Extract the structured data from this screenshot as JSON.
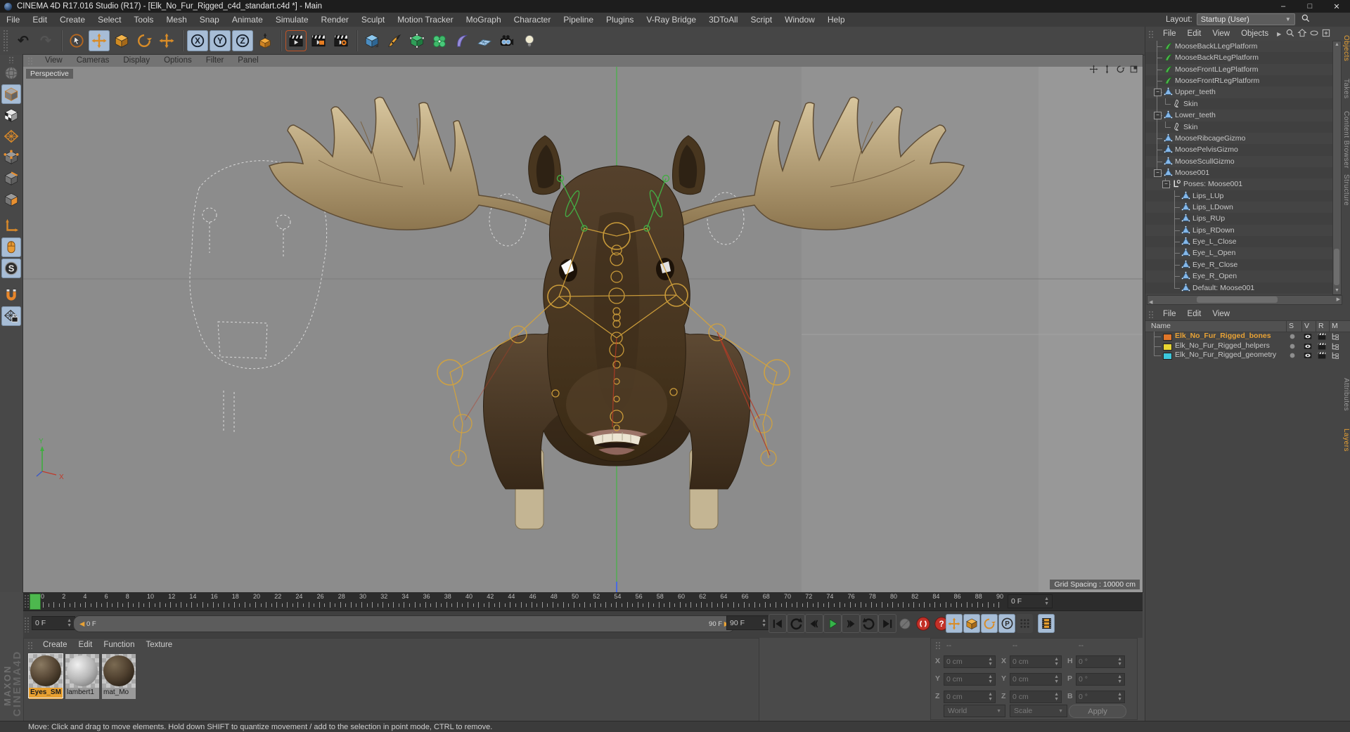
{
  "window": {
    "title": "CINEMA 4D R17.016 Studio (R17) - [Elk_No_Fur_Rigged_c4d_standart.c4d *] - Main"
  },
  "menu_bar": {
    "items": [
      "File",
      "Edit",
      "Create",
      "Select",
      "Tools",
      "Mesh",
      "Snap",
      "Animate",
      "Simulate",
      "Render",
      "Sculpt",
      "Motion Tracker",
      "MoGraph",
      "Character",
      "Pipeline",
      "Plugins",
      "V-Ray Bridge",
      "3DToAll",
      "Script",
      "Window",
      "Help"
    ],
    "layout_label": "Layout:",
    "layout_value": "Startup (User)"
  },
  "toolbar": {
    "tools": [
      {
        "name": "undo",
        "icon": "undo"
      },
      {
        "name": "redo",
        "icon": "redo",
        "disabled": true
      },
      {
        "sep": true
      },
      {
        "name": "live-selection",
        "icon": "live-selection"
      },
      {
        "name": "move-tool",
        "icon": "move",
        "selected": true
      },
      {
        "name": "scale-tool",
        "icon": "scale"
      },
      {
        "name": "rotate-tool",
        "icon": "rotate"
      },
      {
        "name": "last-used-tool",
        "icon": "move"
      },
      {
        "sep": true
      },
      {
        "name": "lock-x-axis",
        "icon": "axis-x",
        "selected": true
      },
      {
        "name": "lock-y-axis",
        "icon": "axis-y",
        "selected": true
      },
      {
        "name": "lock-z-axis",
        "icon": "axis-z",
        "selected": true
      },
      {
        "name": "coordinate-system",
        "icon": "coord-system"
      },
      {
        "sep": true
      },
      {
        "name": "render-view",
        "icon": "render-view",
        "outlined": true
      },
      {
        "name": "render-picture-viewer",
        "icon": "render-pv"
      },
      {
        "name": "render-settings",
        "icon": "render-settings"
      },
      {
        "sep": true
      },
      {
        "name": "add-cube-primitive",
        "icon": "cube-primitive"
      },
      {
        "name": "add-spline-pen",
        "icon": "pen-spline"
      },
      {
        "name": "add-subdivision-surface",
        "icon": "subdivision"
      },
      {
        "name": "add-mograph-object",
        "icon": "mograph"
      },
      {
        "name": "add-deformer",
        "icon": "deformer"
      },
      {
        "name": "add-environment-floor",
        "icon": "floor"
      },
      {
        "name": "add-camera",
        "icon": "camera"
      },
      {
        "name": "add-light",
        "icon": "light"
      }
    ]
  },
  "left_toolbar": {
    "tools": [
      {
        "name": "viewport-navigation-globe",
        "icon": "globe",
        "disabled": true
      },
      {
        "name": "model-mode",
        "icon": "model-mode",
        "selected": true
      },
      {
        "name": "texture-mode",
        "icon": "texture-mode"
      },
      {
        "name": "workplane-mode",
        "icon": "workplane"
      },
      {
        "name": "points-mode",
        "icon": "points-mode"
      },
      {
        "name": "edges-mode",
        "icon": "edges-mode"
      },
      {
        "name": "polygons-mode",
        "icon": "polygons-mode"
      },
      {
        "name": "enable-axis-modification",
        "icon": "axis-mode",
        "gap": 8
      },
      {
        "name": "viewport-interaction-mouse",
        "icon": "mouse",
        "selected": true
      },
      {
        "name": "enable-snap",
        "icon": "snap-s",
        "selected": true
      },
      {
        "name": "magnet-tool",
        "icon": "magnet",
        "gap": 8
      },
      {
        "name": "workplane-snap",
        "icon": "grid-lock",
        "selected": true
      }
    ]
  },
  "viewport": {
    "menu": [
      "View",
      "Cameras",
      "Display",
      "Options",
      "Filter",
      "Panel"
    ],
    "camera_label": "Perspective",
    "grid_spacing_label": "Grid Spacing : 10000 cm",
    "axis_labels": {
      "x": "X",
      "y": "Y"
    },
    "nav_icons": [
      "pan-icon",
      "dolly-icon",
      "orbit-icon",
      "maximize-view-icon"
    ]
  },
  "object_manager": {
    "menu": [
      "File",
      "Edit",
      "View",
      "Objects"
    ],
    "header_icons": [
      "search-icon",
      "home-icon",
      "eye-filter-icon",
      "add-layer-icon"
    ],
    "tabs": [
      {
        "label": "Objects",
        "active": true
      },
      {
        "label": "Takes",
        "active": false
      },
      {
        "label": "Content Browser",
        "active": false
      },
      {
        "label": "Structure",
        "active": false
      }
    ],
    "tree": [
      {
        "label": "MooseBackLLegPlatform",
        "icon": "spline",
        "indent": 1,
        "conn": "mid"
      },
      {
        "label": "MooseBackRLegPlatform",
        "icon": "spline",
        "indent": 1,
        "conn": "mid"
      },
      {
        "label": "MooseFrontLLegPlatform",
        "icon": "spline",
        "indent": 1,
        "conn": "mid"
      },
      {
        "label": "MooseFrontRLegPlatform",
        "icon": "spline",
        "indent": 1,
        "conn": "mid"
      },
      {
        "label": "Upper_teeth",
        "icon": "joint",
        "indent": 1,
        "conn": "mid",
        "expand": true
      },
      {
        "label": "Skin",
        "icon": "skin",
        "indent": 2,
        "conn": "end",
        "guide1": true
      },
      {
        "label": "Lower_teeth",
        "icon": "joint",
        "indent": 1,
        "conn": "mid",
        "expand": true
      },
      {
        "label": "Skin",
        "icon": "skin",
        "indent": 2,
        "conn": "end",
        "guide1": true
      },
      {
        "label": "MooseRibcageGizmo",
        "icon": "joint",
        "indent": 1,
        "conn": "mid"
      },
      {
        "label": "MoosePelvisGizmo",
        "icon": "joint",
        "indent": 1,
        "conn": "mid"
      },
      {
        "label": "MooseScullGizmo",
        "icon": "joint",
        "indent": 1,
        "conn": "mid"
      },
      {
        "label": "Moose001",
        "icon": "joint",
        "indent": 1,
        "conn": "end",
        "expand": true
      },
      {
        "label": "Poses: Moose001",
        "icon": "posemorph",
        "indent": 2,
        "conn": "end",
        "expand": true
      },
      {
        "label": "Lips_LUp",
        "icon": "joint",
        "indent": 3,
        "conn": "mid"
      },
      {
        "label": "Lips_LDown",
        "icon": "joint",
        "indent": 3,
        "conn": "mid"
      },
      {
        "label": "Lips_RUp",
        "icon": "joint",
        "indent": 3,
        "conn": "mid"
      },
      {
        "label": "Lips_RDown",
        "icon": "joint",
        "indent": 3,
        "conn": "mid"
      },
      {
        "label": "Eye_L_Close",
        "icon": "joint",
        "indent": 3,
        "conn": "mid"
      },
      {
        "label": "Eye_L_Open",
        "icon": "joint",
        "indent": 3,
        "conn": "mid"
      },
      {
        "label": "Eye_R_Close",
        "icon": "joint",
        "indent": 3,
        "conn": "mid"
      },
      {
        "label": "Eye_R_Open",
        "icon": "joint",
        "indent": 3,
        "conn": "mid"
      },
      {
        "label": "Default: Moose001",
        "icon": "joint",
        "indent": 3,
        "conn": "end"
      }
    ]
  },
  "layer_manager": {
    "menu": [
      "File",
      "Edit",
      "View"
    ],
    "name_column": "Name",
    "columns": [
      "S",
      "V",
      "R",
      "M"
    ],
    "tabs": [
      {
        "label": "Attributes",
        "active": false
      },
      {
        "label": "Layers",
        "active": true
      }
    ],
    "layers": [
      {
        "label": "Elk_No_Fur_Rigged_bones",
        "color": "#e0762a",
        "selected": true
      },
      {
        "label": "Elk_No_Fur_Rigged_helpers",
        "color": "#e8d532",
        "selected": false
      },
      {
        "label": "Elk_No_Fur_Rigged_geometry",
        "color": "#3cc8dc",
        "selected": false
      }
    ]
  },
  "timeline": {
    "ruler_start": 0,
    "ruler_end": 90,
    "ruler_step": 2,
    "current_frame_label": "0 F",
    "slider_min_label": "0 F",
    "slider_max_label": "90 F",
    "max_frame_label": "90 F",
    "top_right_spinner_label": "0 F",
    "transport": [
      {
        "name": "goto-start-button",
        "icon": "goto-start"
      },
      {
        "name": "play-backwards-button",
        "icon": "arc-left"
      },
      {
        "name": "previous-frame-button",
        "icon": "tri-left"
      },
      {
        "name": "play-forwards-button",
        "icon": "play"
      },
      {
        "name": "next-frame-button",
        "icon": "tri-right"
      },
      {
        "name": "play-loop-button",
        "icon": "arc-right"
      },
      {
        "name": "goto-end-button",
        "icon": "goto-end"
      }
    ],
    "record": [
      {
        "name": "record-active-objects-button",
        "icon": "sphere-gray",
        "disabled": true
      },
      {
        "name": "autokeying-button",
        "icon": "record-red"
      },
      {
        "name": "keying-help-button",
        "icon": "question-red"
      }
    ],
    "key_toggles": [
      {
        "name": "key-position-toggle",
        "icon": "move",
        "selected": true
      },
      {
        "name": "key-scale-toggle",
        "icon": "scale",
        "selected": true
      },
      {
        "name": "key-rotation-toggle",
        "icon": "rotate",
        "selected": true
      },
      {
        "name": "key-parameter-toggle",
        "icon": "parameter-p",
        "selected": true
      },
      {
        "name": "key-point-level-toggle",
        "icon": "dots-grid",
        "selected": false
      },
      {
        "name": "open-timeline-button",
        "icon": "film",
        "selected": true
      }
    ]
  },
  "materials": {
    "menu": [
      "Create",
      "Edit",
      "Function",
      "Texture"
    ],
    "items": [
      {
        "name": "Eyes_SM",
        "selected": true,
        "look": "brown"
      },
      {
        "name": "lambert1",
        "selected": false,
        "look": "gray"
      },
      {
        "name": "mat_Mo",
        "selected": false,
        "look": "brown2"
      }
    ]
  },
  "coordinates": {
    "headers": [
      "--",
      "--",
      "--"
    ],
    "groups": [
      {
        "fields": [
          {
            "label": "X",
            "value": "0 cm"
          },
          {
            "label": "Y",
            "value": "0 cm"
          },
          {
            "label": "Z",
            "value": "0 cm"
          }
        ],
        "dropdown": "World"
      },
      {
        "fields": [
          {
            "label": "X",
            "value": "0 cm"
          },
          {
            "label": "Y",
            "value": "0 cm"
          },
          {
            "label": "Z",
            "value": "0 cm"
          }
        ],
        "dropdown": "Scale"
      },
      {
        "fields": [
          {
            "label": "H",
            "value": "0 °"
          },
          {
            "label": "P",
            "value": "0 °"
          },
          {
            "label": "B",
            "value": "0 °"
          }
        ],
        "dropdown": null
      }
    ],
    "apply_label": "Apply"
  },
  "status_bar": {
    "text": "Move: Click and drag to move elements. Hold down SHIFT to quantize movement / add to the selection in point mode, CTRL to remove."
  },
  "branding": {
    "line1": "MAXON",
    "line2": "CINEMA4D"
  },
  "colors": {
    "accent_orange": "#e8962e",
    "selected_tool_blue": "#a7bdd6",
    "play_green": "#37b24a",
    "record_red": "#c23028",
    "timeline_marker_green": "#4db84e"
  }
}
